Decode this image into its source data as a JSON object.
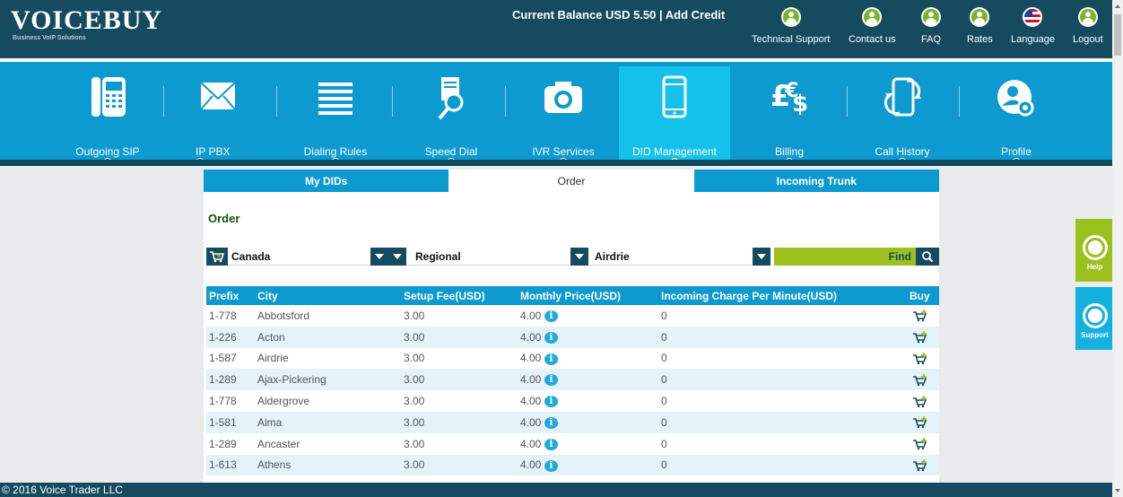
{
  "brand": {
    "logo": "VOICEBUY",
    "tagline": "Business VoIP Solutions"
  },
  "header": {
    "balance_text": "Current Balance USD 5.50 | Add Credit",
    "links": [
      {
        "label": "Technical Support",
        "icon": "user-icon"
      },
      {
        "label": "Contact us",
        "icon": "user-icon"
      },
      {
        "label": "FAQ",
        "icon": "user-icon"
      },
      {
        "label": "Rates",
        "icon": "user-icon"
      },
      {
        "label": "Language",
        "icon": "flag-icon"
      },
      {
        "label": "Logout",
        "icon": "user-icon"
      }
    ]
  },
  "mainnav": {
    "items": [
      {
        "label": "Outgoing SIP",
        "icon": "phone-icon"
      },
      {
        "label": "IP PBX",
        "icon": "envelope-icon"
      },
      {
        "label": "Dialing Rules",
        "icon": "list-icon"
      },
      {
        "label": "Speed Dial",
        "icon": "search-document-icon"
      },
      {
        "label": "IVR Services",
        "icon": "camera-icon"
      },
      {
        "label": "DID Management",
        "icon": "mobile-icon"
      },
      {
        "label": "Billing",
        "icon": "currency-icon"
      },
      {
        "label": "Call History",
        "icon": "phone-refresh-icon"
      },
      {
        "label": "Profile",
        "icon": "profile-gear-icon"
      }
    ],
    "active": "DID Management"
  },
  "subtabs": [
    {
      "label": "My DIDs"
    },
    {
      "label": "Order"
    },
    {
      "label": "Incoming Trunk"
    }
  ],
  "order": {
    "title": "Order",
    "filters": {
      "country": "Canada",
      "type": "Regional",
      "city": "Airdrie"
    },
    "find_label": "Find"
  },
  "table": {
    "columns": [
      "Prefix",
      "City",
      "Setup Fee(USD)",
      "Monthly Price(USD)",
      "Incoming Charge Per Minute(USD)",
      "Buy"
    ],
    "rows": [
      [
        "1-778",
        "Abbotsford",
        "3.00",
        "4.00",
        "0"
      ],
      [
        "1-226",
        "Acton",
        "3.00",
        "4.00",
        "0"
      ],
      [
        "1-587",
        "Airdrie",
        "3.00",
        "4.00",
        "0"
      ],
      [
        "1-289",
        "Ajax-Pickering",
        "3.00",
        "4.00",
        "0"
      ],
      [
        "1-778",
        "Aldergrove",
        "3.00",
        "4.00",
        "0"
      ],
      [
        "1-581",
        "Alma",
        "3.00",
        "4.00",
        "0"
      ],
      [
        "1-289",
        "Ancaster",
        "3.00",
        "4.00",
        "0"
      ],
      [
        "1-613",
        "Athens",
        "3.00",
        "4.00",
        "0"
      ]
    ]
  },
  "side": {
    "help": "Help",
    "support": "Support",
    "help_color": "#9bc01d",
    "support_color": "#14b1e0"
  },
  "footer": {
    "text": "© 2016 Voice Trader LLC"
  },
  "colors": {
    "brand_dark": "#164b5f",
    "brand_blue": "#0c9ad0",
    "active_blue": "#14c1ea",
    "accent_orange": "#f1a800",
    "green": "#9bc01d"
  }
}
